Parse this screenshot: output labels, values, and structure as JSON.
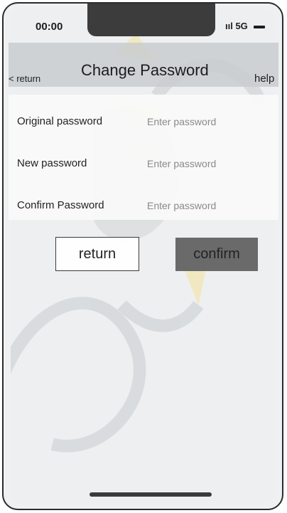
{
  "status_bar": {
    "time": "00:00",
    "signal": "∙∙∙∙ 5G"
  },
  "header": {
    "back_label": "< return",
    "title": "Change Password",
    "help_label": "help"
  },
  "form": {
    "rows": [
      {
        "label": "Original password",
        "placeholder": "Enter password"
      },
      {
        "label": "New password",
        "placeholder": "Enter password"
      },
      {
        "label": "Confirm Password",
        "placeholder": "Enter password"
      }
    ]
  },
  "actions": {
    "return_label": "return",
    "confirm_label": "confirm"
  },
  "colors": {
    "header_bg": "#c8ccd0",
    "confirm_bg": "#6a6a6a",
    "screen_bg": "#edeff0"
  }
}
